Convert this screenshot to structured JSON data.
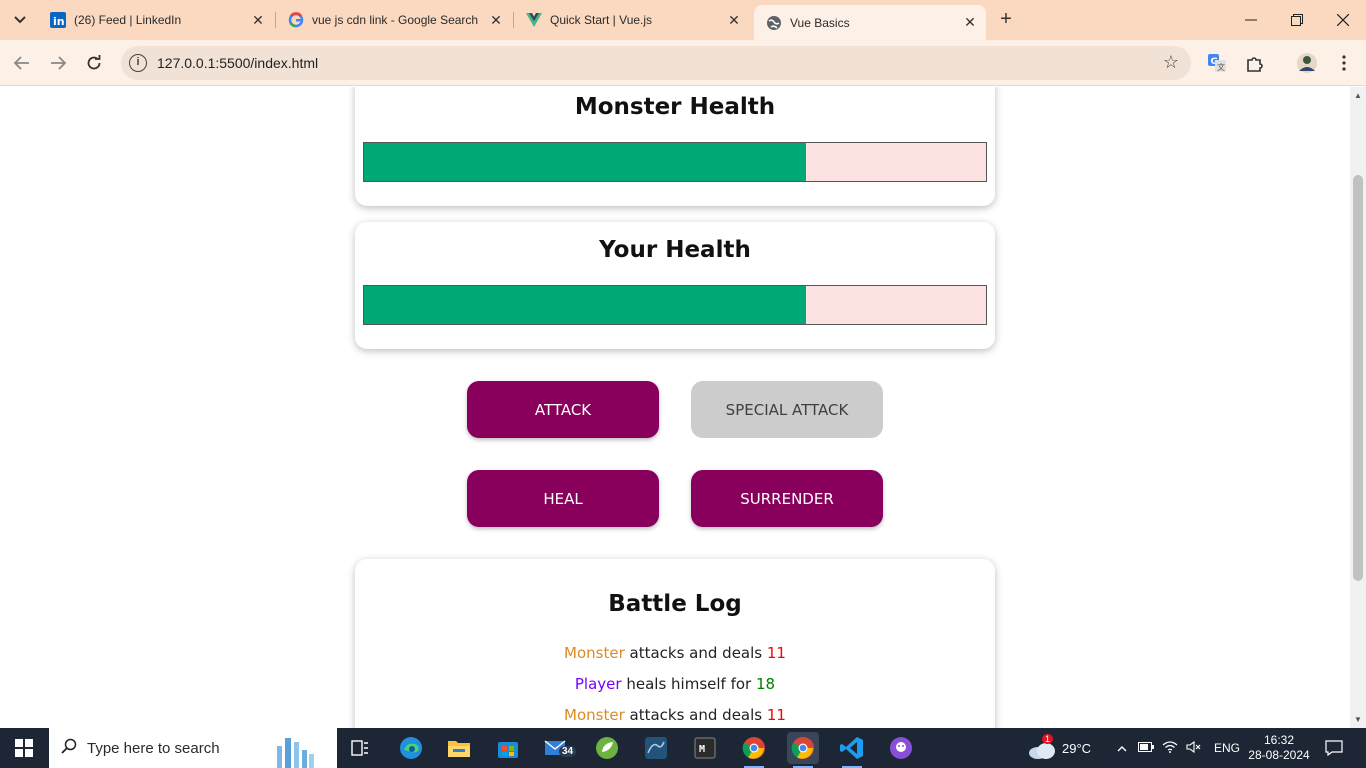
{
  "browser": {
    "tabs": [
      {
        "title": "(26) Feed | LinkedIn",
        "icon": "linkedin-icon"
      },
      {
        "title": "vue js cdn link - Google Search",
        "icon": "google-icon"
      },
      {
        "title": "Quick Start | Vue.js",
        "icon": "vue-icon"
      },
      {
        "title": "Vue Basics",
        "icon": "globe-icon",
        "active": true
      }
    ],
    "url": "127.0.0.1:5500/index.html"
  },
  "page": {
    "monster_health": {
      "title": "Monster Health",
      "value_percent": 71
    },
    "player_health": {
      "title": "Your Health",
      "value_percent": 71
    },
    "controls": {
      "attack": "ATTACK",
      "special_attack": "SPECIAL ATTACK",
      "heal": "HEAL",
      "surrender": "SURRENDER"
    },
    "battle_log": {
      "title": "Battle Log",
      "entries": [
        {
          "actor": "Monster",
          "action": "attacks and deals",
          "value": "11",
          "type": "damage"
        },
        {
          "actor": "Player",
          "action": "heals himself for",
          "value": "18",
          "type": "heal"
        },
        {
          "actor": "Monster",
          "action": "attacks and deals",
          "value": "11",
          "type": "damage"
        }
      ]
    }
  },
  "taskbar": {
    "search_placeholder": "Type here to search",
    "mail_badge": "34",
    "weather_temp": "29°C",
    "weather_badge": "1",
    "language": "ENG",
    "time": "16:32",
    "date": "28-08-2024"
  },
  "colors": {
    "health_fill": "#00a876",
    "health_empty": "#fde2e2",
    "button_primary": "#88005b",
    "button_disabled": "#cccccc",
    "log_monster": "#dc8a27",
    "log_player": "#7700ff",
    "log_damage": "#ff0000",
    "log_heal": "#008000"
  }
}
